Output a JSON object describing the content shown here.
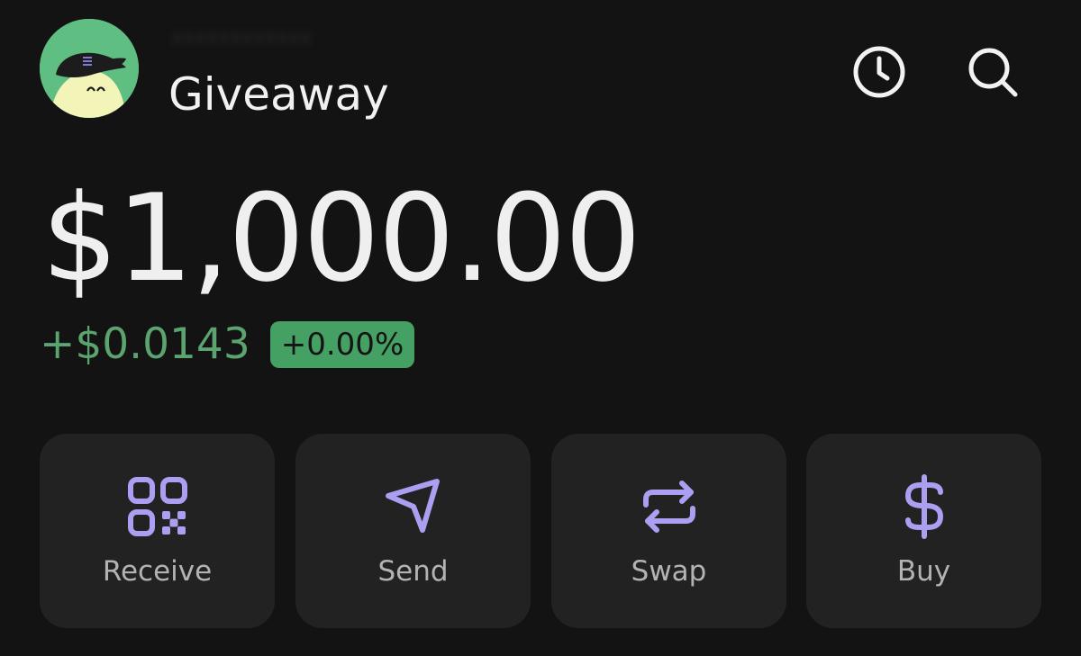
{
  "header": {
    "account_name": "Giveaway",
    "account_subtitle": "xxxxxxxxxxxx",
    "icons": [
      "avatar-ghost-icon",
      "history-clock-icon",
      "search-icon"
    ]
  },
  "balance": {
    "total": "$1,000.00",
    "change_amount": "+$0.0143",
    "change_percent": "+0.00%"
  },
  "actions": [
    {
      "label": "Receive",
      "icon": "qr-code-icon"
    },
    {
      "label": "Send",
      "icon": "send-arrow-icon"
    },
    {
      "label": "Swap",
      "icon": "swap-arrows-icon"
    },
    {
      "label": "Buy",
      "icon": "dollar-icon"
    }
  ],
  "colors": {
    "background": "#131313",
    "card": "#222222",
    "accent_purple": "#aa9ff0",
    "positive_green": "#5ba36f",
    "badge_green": "#45a163",
    "avatar_green": "#5fbf83"
  }
}
